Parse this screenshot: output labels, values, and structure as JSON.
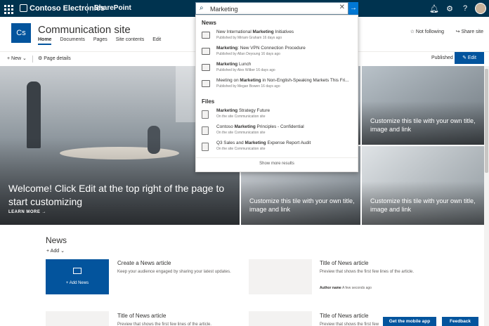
{
  "suite": {
    "brand": "Contoso Electronics",
    "app_name": "SharePoint"
  },
  "search": {
    "value": "Marketing",
    "placeholder": "Search"
  },
  "site": {
    "logo": "Cs",
    "title": "Communication site",
    "nav": [
      "Home",
      "Documents",
      "Pages",
      "Site contents",
      "Edit"
    ],
    "follow": "Not following",
    "share": "Share site"
  },
  "commands": {
    "new": "New",
    "page_details": "Page details",
    "published": "Published",
    "edit": "Edit"
  },
  "dropdown": {
    "news_heading": "News",
    "files_heading": "Files",
    "news": [
      {
        "before": "New International ",
        "bold": "Marketing",
        "after": " Initiatives",
        "meta": "Published by Miriam Graham 16 days ago"
      },
      {
        "before": "",
        "bold": "Marketing",
        "after": ": New VPN Connection Procedure",
        "meta": "Published by Allan Deyoung 16 days ago"
      },
      {
        "before": "",
        "bold": "Marketing",
        "after": " Lunch",
        "meta": "Published by Alex Wilber 16 days ago"
      },
      {
        "before": "Meeting on ",
        "bold": "Marketing",
        "after": " in Non-English-Speaking Markets This Fri...",
        "meta": "Published by Megan Bowen 16 days ago"
      }
    ],
    "files": [
      {
        "before": "",
        "bold": "Marketing",
        "after": " Strategy Future",
        "meta": "On the site Communication site"
      },
      {
        "before": "Contoso ",
        "bold": "Marketing",
        "after": " Principles - Confidential",
        "meta": "On the site Communication site"
      },
      {
        "before": "Q3 Sales and ",
        "bold": "Marketing",
        "after": " Expense Report Audit",
        "meta": "On the site Communication site"
      }
    ],
    "more": "Show more results"
  },
  "hero": {
    "main_title": "Welcome! Click Edit at the top right of the page to start customizing",
    "main_link": "LEARN MORE →",
    "tile_text": "Customize this tile with your own title, image and link"
  },
  "news": {
    "title": "News",
    "add": "Add",
    "create_label": "Add News",
    "create_title": "Create a News article",
    "create_desc": "Keep your audience engaged by sharing your latest updates.",
    "article_title": "Title of News article",
    "article_desc": "Preview that shows the first few lines of the article.",
    "author": "Author name",
    "age": "A few seconds ago"
  },
  "footer": {
    "mobile": "Get the mobile app",
    "feedback": "Feedback"
  },
  "colors": {
    "suite_bar": "#00334f",
    "accent": "#03549d"
  }
}
